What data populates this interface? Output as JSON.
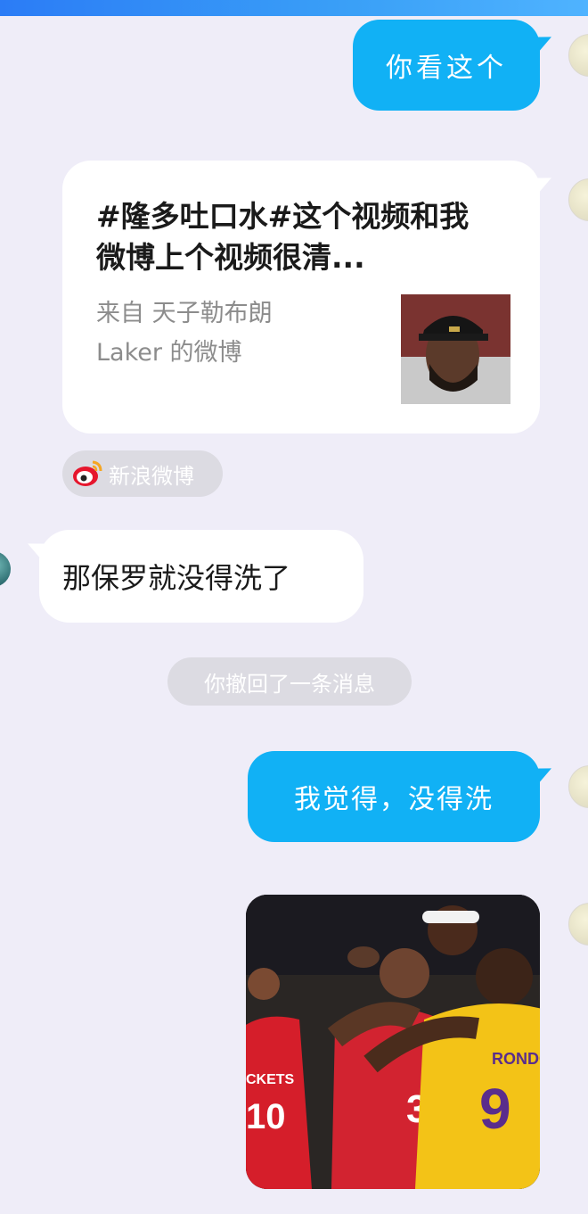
{
  "messages": {
    "sent_1": "你看这个",
    "card": {
      "title": "#隆多吐口水#这个视频和我微博上个视频很清...",
      "source_line1": "来自 天子勒布朗",
      "source_line2": "Laker 的微博",
      "app_label": "新浪微博"
    },
    "received_1": "那保罗就没得洗了",
    "system_notice": "你撤回了一条消息",
    "sent_2": "我觉得，没得洗"
  },
  "photo_text": {
    "jersey_left": "CKETS",
    "jersey_left_num": "10",
    "jersey_mid_num": "3",
    "jersey_right_name": "RONDO",
    "jersey_right_num": "9"
  },
  "colors": {
    "background": "#efedf8",
    "sent_bubble": "#11b1f5",
    "received_bubble": "#ffffff",
    "pill": "#dcdbe2",
    "weibo_red": "#e6162d"
  }
}
